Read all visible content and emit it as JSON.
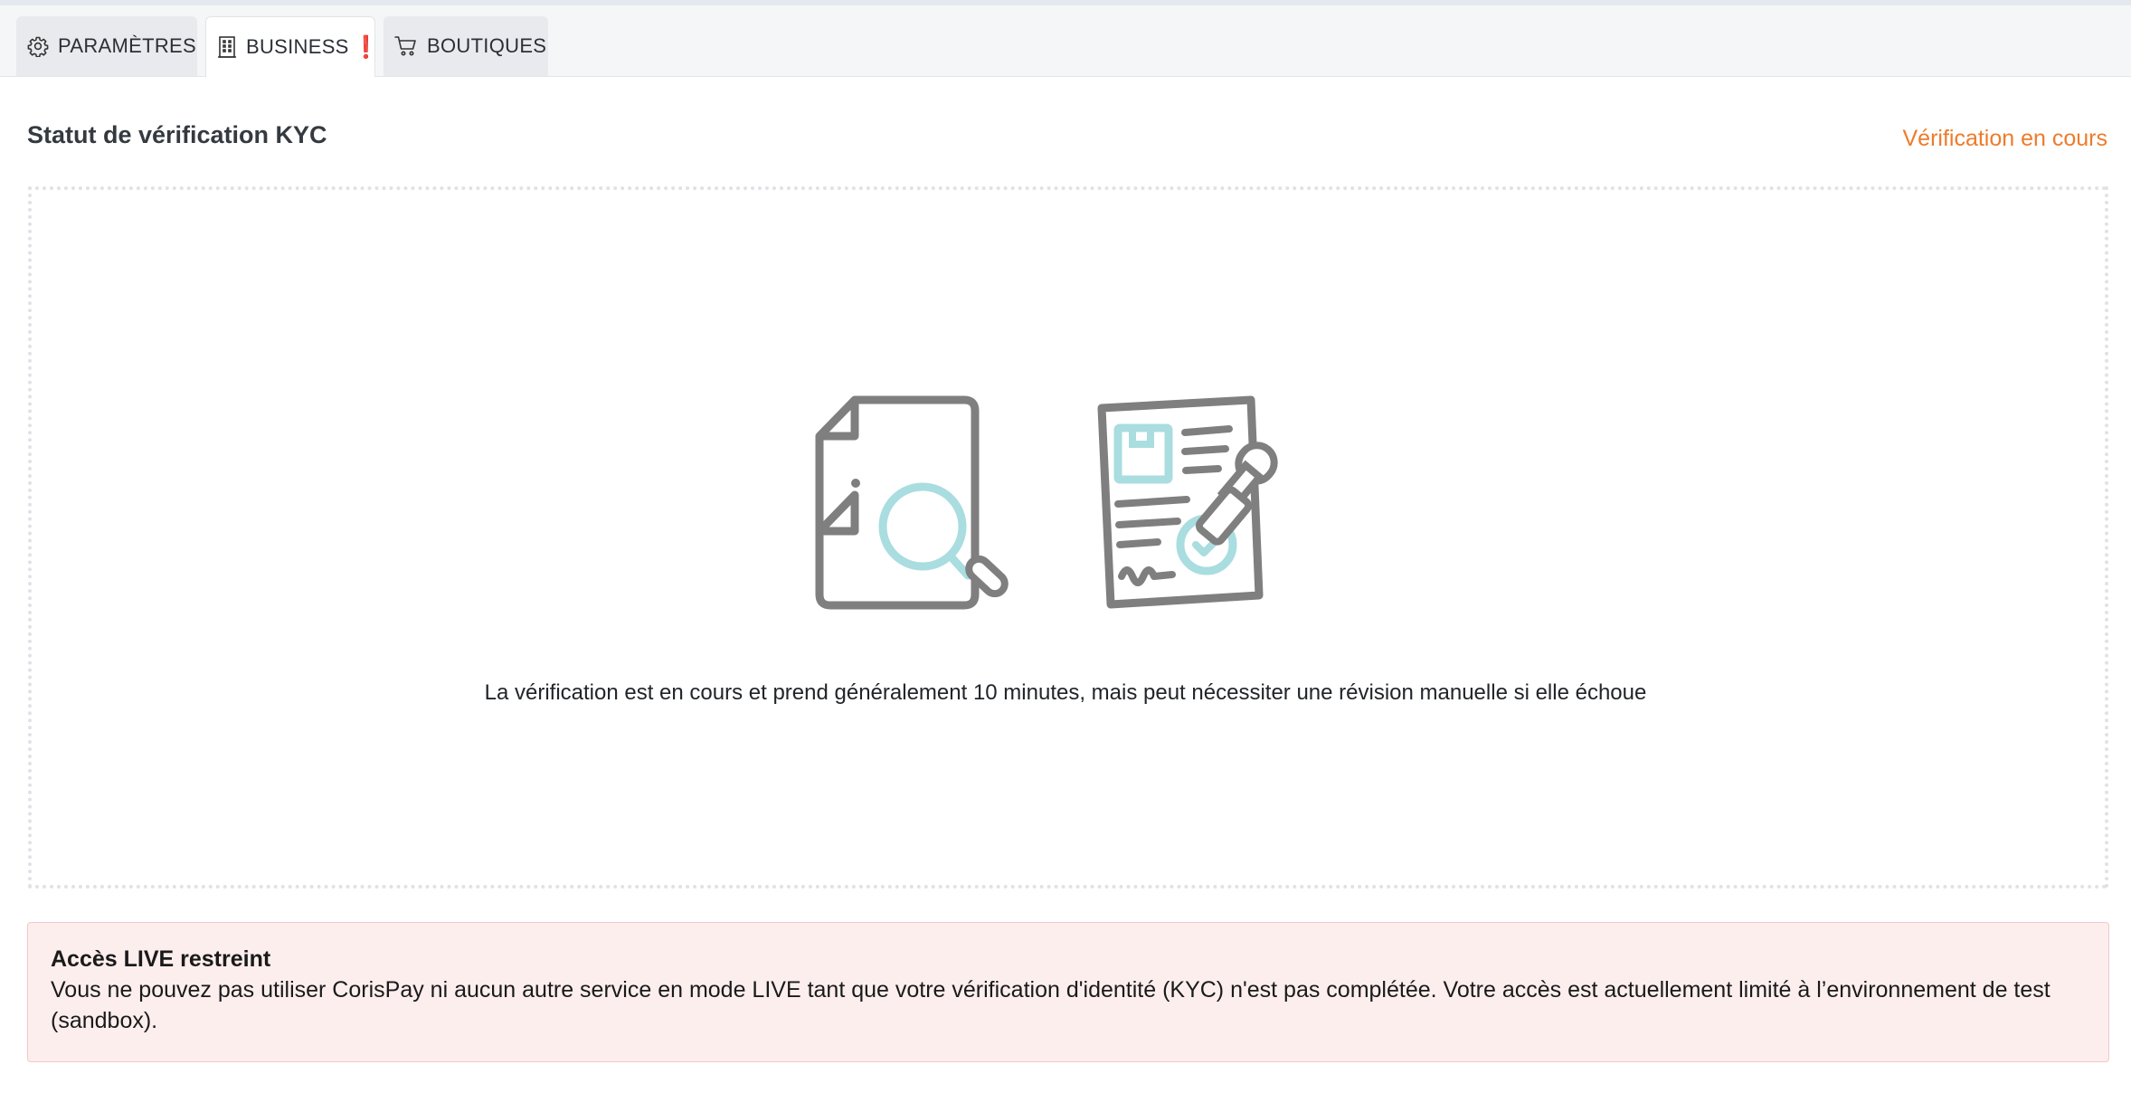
{
  "tabs": [
    {
      "label": "PARAMÈTRES",
      "icon": "gear-icon",
      "active": false
    },
    {
      "label": "BUSINESS",
      "icon": "building-icon",
      "active": true,
      "badge": "❗"
    },
    {
      "label": "BOUTIQUES",
      "icon": "cart-icon",
      "active": false
    }
  ],
  "kyc": {
    "title": "Statut de vérification KYC",
    "status": "Vérification en cours",
    "message": "La vérification est en cours et prend généralement 10 minutes, mais peut nécessiter une révision manuelle si elle échoue"
  },
  "alert": {
    "title": "Accès LIVE restreint",
    "body": "Vous ne pouvez pas utiliser CorisPay ni aucun autre service en mode LIVE tant que votre vérification d'identité (KYC) n'est pas complétée. Votre accès est actuellement limité à l’environnement de test (sandbox)."
  },
  "colors": {
    "status_orange": "#ee7b2a",
    "alert_background": "#fdeeee",
    "alert_border": "#f3c7cb",
    "illustration_gray": "#7f7f7f",
    "illustration_teal": "#a9dde0"
  }
}
